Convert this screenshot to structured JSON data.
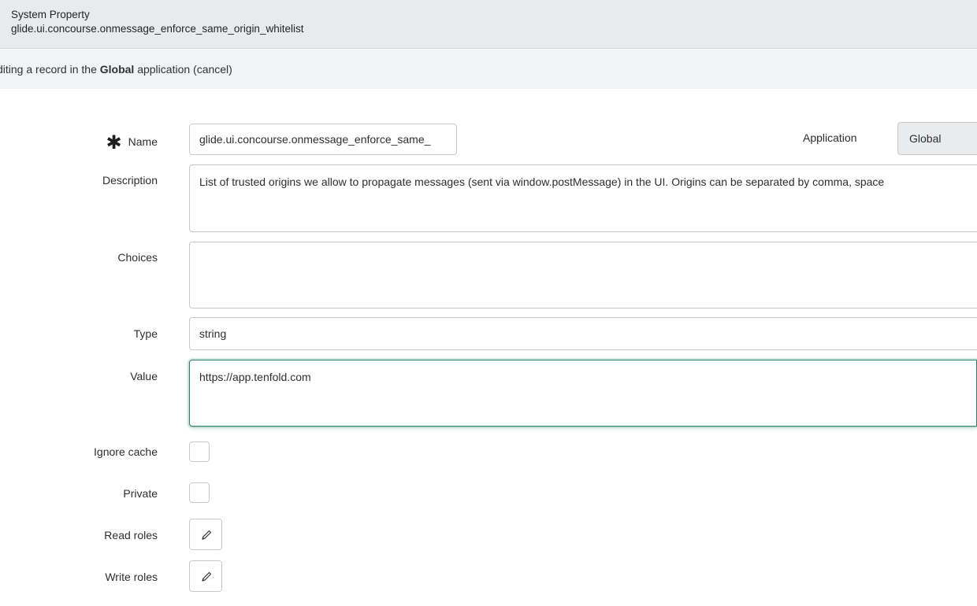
{
  "header": {
    "title": "System Property",
    "subtitle": "glide.ui.concourse.onmessage_enforce_same_origin_whitelist"
  },
  "banner": {
    "prefix": "diting a record in the ",
    "app_name": "Global",
    "suffix": " application ",
    "cancel_label": "(cancel)"
  },
  "form": {
    "name": {
      "label": "Name",
      "required_mark": "✱",
      "value": "glide.ui.concourse.onmessage_enforce_same_"
    },
    "application": {
      "label": "Application",
      "value": "Global"
    },
    "description": {
      "label": "Description",
      "value": "List of trusted origins we allow to propagate messages (sent via window.postMessage) in the UI. Origins can be separated by comma, space"
    },
    "choices": {
      "label": "Choices",
      "value": ""
    },
    "type": {
      "label": "Type",
      "value": "string"
    },
    "value": {
      "label": "Value",
      "value": "https://app.tenfold.com"
    },
    "ignore_cache": {
      "label": "Ignore cache",
      "checked": false
    },
    "private": {
      "label": "Private",
      "checked": false
    },
    "read_roles": {
      "label": "Read roles",
      "icon": "pencil-icon"
    },
    "write_roles": {
      "label": "Write roles",
      "icon": "pencil-icon"
    }
  },
  "colors": {
    "focus_border": "#2d7d67",
    "header_bg": "#e8eaec",
    "banner_bg": "#f1f3f4"
  }
}
